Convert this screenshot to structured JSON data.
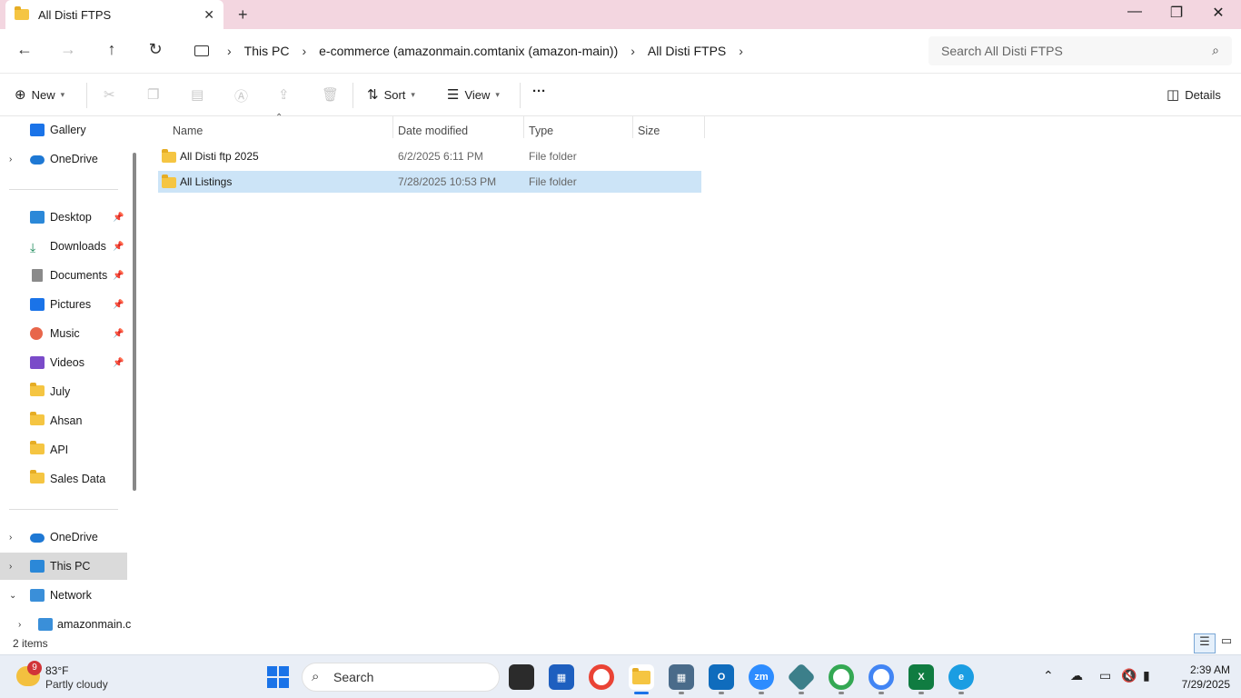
{
  "window": {
    "tab_title": "All Disti FTPS",
    "new_tab_symbol": "+",
    "close_symbol": "✕"
  },
  "nav": {
    "back": "←",
    "forward": "→",
    "up": "↑",
    "refresh": "↻"
  },
  "address": {
    "crumbs": [
      "This PC",
      "e-commerce (amazonmain.comtanix (amazon-main))",
      "All Disti FTPS"
    ]
  },
  "search": {
    "placeholder": "Search All Disti FTPS"
  },
  "commandbar": {
    "new_label": "New",
    "sort_label": "Sort",
    "view_label": "View",
    "more_label": "···",
    "details_label": "Details"
  },
  "sidebar": {
    "items": [
      {
        "label": "Gallery",
        "icon": "gallery-icon"
      },
      {
        "label": "OneDrive",
        "icon": "cloud-icon"
      },
      {
        "label": "Desktop",
        "icon": "desktop-icon"
      },
      {
        "label": "Downloads",
        "icon": "download-icon"
      },
      {
        "label": "Documents",
        "icon": "document-icon"
      },
      {
        "label": "Pictures",
        "icon": "pictures-icon"
      },
      {
        "label": "Music",
        "icon": "music-icon"
      },
      {
        "label": "Videos",
        "icon": "videos-icon"
      },
      {
        "label": "July",
        "icon": "folder-icon"
      },
      {
        "label": "Ahsan",
        "icon": "folder-icon"
      },
      {
        "label": "API",
        "icon": "folder-icon"
      },
      {
        "label": "Sales Data",
        "icon": "folder-icon"
      },
      {
        "label": "OneDrive",
        "icon": "cloud-icon"
      },
      {
        "label": "This PC",
        "icon": "computer-icon"
      },
      {
        "label": "Network",
        "icon": "network-icon"
      },
      {
        "label": "amazonmain.c",
        "icon": "drive-icon"
      }
    ]
  },
  "columns": {
    "name": "Name",
    "date": "Date modified",
    "type": "Type",
    "size": "Size"
  },
  "files": [
    {
      "name": "All Disti ftp 2025",
      "date": "6/2/2025 6:11 PM",
      "type": "File folder"
    },
    {
      "name": "All Listings",
      "date": "7/28/2025 10:53 PM",
      "type": "File folder"
    }
  ],
  "status": {
    "count": "2 items"
  },
  "taskbar": {
    "weather_badge": "9",
    "temperature": "83°F",
    "condition": "Partly cloudy",
    "search_label": "Search",
    "time": "2:39 AM",
    "date": "7/29/2025",
    "colors": {
      "windows": "#1a73e8",
      "chrome": "#ea4335",
      "outlook": "#0f6cbd",
      "zoom": "#2d8cff",
      "excel": "#107c41",
      "edge": "#1b9de2"
    }
  }
}
